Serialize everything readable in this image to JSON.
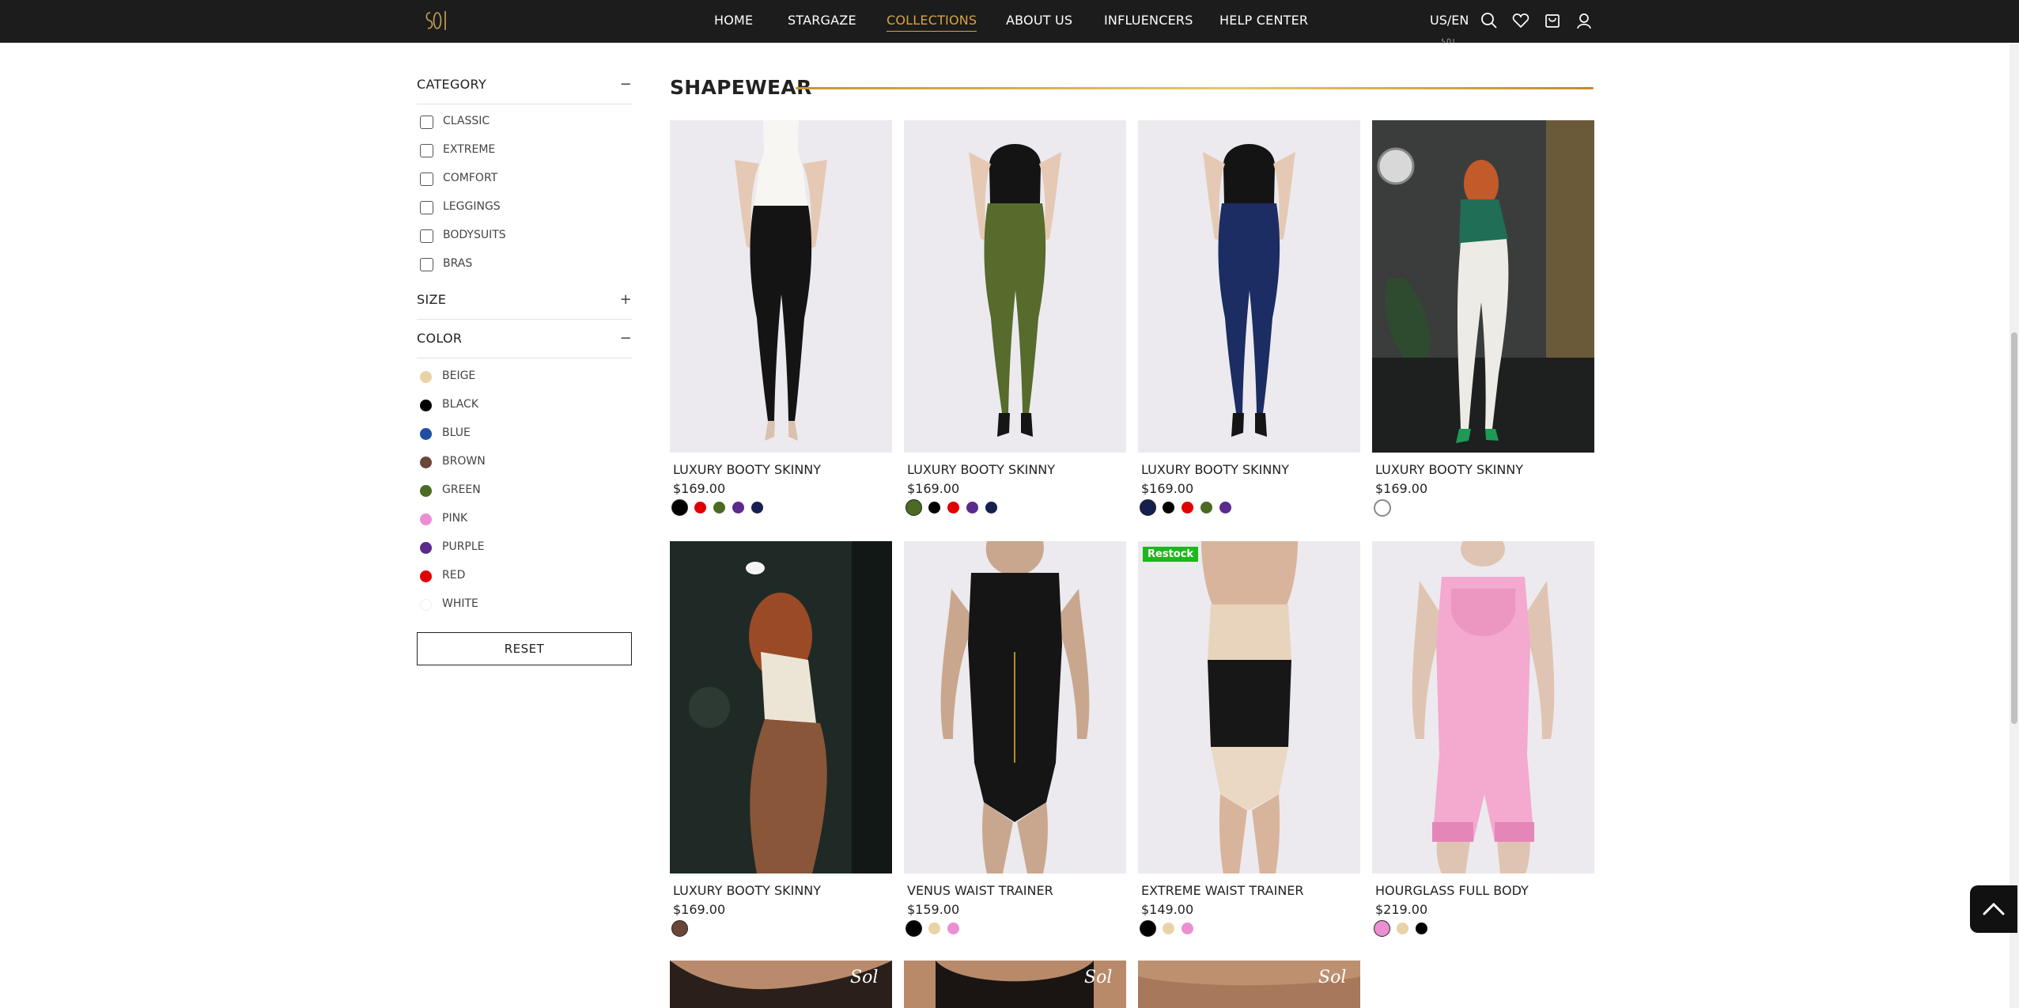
{
  "nav": {
    "logo_text": "Sol",
    "links": [
      {
        "label": "HOME"
      },
      {
        "label": "STARGAZE"
      },
      {
        "label": "COLLECTIONS"
      },
      {
        "label": "ABOUT US"
      },
      {
        "label": "INFLUENCERS"
      },
      {
        "label": "HELP CENTER"
      }
    ],
    "active": "COLLECTIONS",
    "active_color": "#d9a441",
    "locale": "US/EN",
    "icons": [
      "search-icon",
      "heart-icon",
      "cart-icon",
      "user-icon"
    ]
  },
  "sidebar": {
    "category": {
      "title": "CATEGORY",
      "toggle": "−",
      "items": [
        {
          "label": "CLASSIC"
        },
        {
          "label": "EXTREME"
        },
        {
          "label": "COMFORT"
        },
        {
          "label": "LEGGINGS"
        },
        {
          "label": "BODYSUITS"
        },
        {
          "label": "BRAS"
        }
      ]
    },
    "size": {
      "title": "SIZE",
      "toggle": "+"
    },
    "color": {
      "title": "COLOR",
      "toggle": "−",
      "items": [
        {
          "label": "BEIGE",
          "hex": "#e8d3a8"
        },
        {
          "label": "BLACK",
          "hex": "#000000"
        },
        {
          "label": "BLUE",
          "hex": "#1e4ea0"
        },
        {
          "label": "BROWN",
          "hex": "#6b4638"
        },
        {
          "label": "GREEN",
          "hex": "#4a6b23"
        },
        {
          "label": "PINK",
          "hex": "#ec8fd2"
        },
        {
          "label": "PURPLE",
          "hex": "#5a2a8c"
        },
        {
          "label": "RED",
          "hex": "#e00000"
        },
        {
          "label": "WHITE",
          "hex": "#ffffff"
        }
      ]
    },
    "reset_label": "RESET"
  },
  "main": {
    "section_title": "SHAPEWEAR",
    "products": [
      {
        "name": "LUXURY BOOTY SKINNY",
        "price": "$169.00",
        "swatches": [
          "#000000",
          "#e00000",
          "#4a6b23",
          "#5a2a8c",
          "#15204f"
        ],
        "selected": 0
      },
      {
        "name": "LUXURY BOOTY SKINNY",
        "price": "$169.00",
        "swatches": [
          "#4a6b23",
          "#000000",
          "#e00000",
          "#5a2a8c",
          "#15204f"
        ],
        "selected": 0
      },
      {
        "name": "LUXURY BOOTY SKINNY",
        "price": "$169.00",
        "swatches": [
          "#15204f",
          "#000000",
          "#e00000",
          "#4a6b23",
          "#5a2a8c"
        ],
        "selected": 0
      },
      {
        "name": "LUXURY BOOTY SKINNY",
        "price": "$169.00",
        "swatches": [
          "#ffffff"
        ],
        "selected": 0
      },
      {
        "name": "LUXURY BOOTY SKINNY",
        "price": "$169.00",
        "swatches": [
          "#6b4638"
        ],
        "selected": 0
      },
      {
        "name": "VENUS WAIST TRAINER",
        "price": "$159.00",
        "swatches": [
          "#000000",
          "#e8d3a8",
          "#ec8fd2"
        ],
        "selected": 0
      },
      {
        "name": "EXTREME WAIST TRAINER",
        "price": "$149.00",
        "swatches": [
          "#000000",
          "#e8d3a8",
          "#ec8fd2"
        ],
        "selected": 0,
        "badge": "Restock"
      },
      {
        "name": "HOURGLASS FULL BODY",
        "price": "$219.00",
        "swatches": [
          "#ec8fd2",
          "#e8d3a8",
          "#000000"
        ],
        "selected": 0
      }
    ],
    "bottom_row_logo_text": "Sol"
  }
}
